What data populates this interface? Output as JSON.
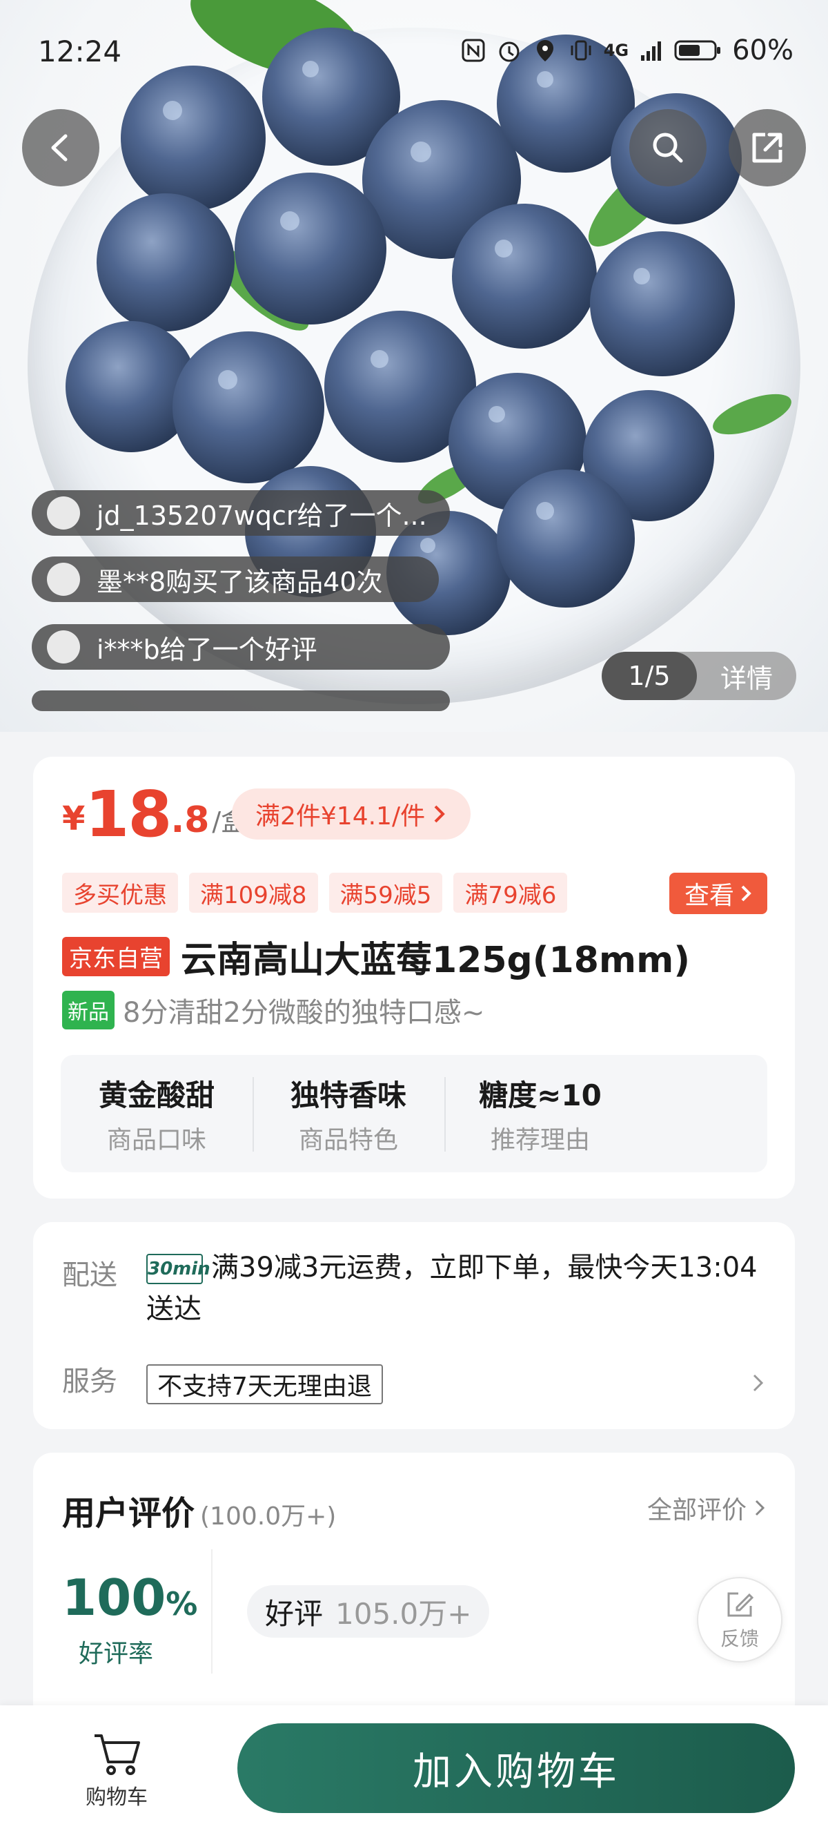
{
  "status_bar": {
    "time": "12:24",
    "battery": "60%",
    "network": "4G"
  },
  "hero": {
    "tickers": [
      {
        "text": "jd_135207wqcr给了一个..."
      },
      {
        "text": "墨**8购买了该商品40次"
      },
      {
        "text": "i***b给了一个好评"
      }
    ],
    "pager_count": "1/5",
    "pager_detail": "详情",
    "icons": {
      "back": "back-arrow-icon",
      "search": "search-icon",
      "share": "share-icon"
    }
  },
  "product": {
    "price_symbol": "¥",
    "price_integer": "18",
    "price_decimal": ".8",
    "price_unit": "/盒",
    "promo": "满2件¥14.1/件",
    "tags": [
      "多买优惠",
      "满109减8",
      "满59减5",
      "满79减6"
    ],
    "view_button": "查看",
    "badge": "京东自营",
    "title": "云南高山大蓝莓125g(18mm)",
    "new_badge": "新品",
    "subtitle": "8分清甜2分微酸的独特口感~",
    "features": [
      {
        "main": "黄金酸甜",
        "sub": "商品口味"
      },
      {
        "main": "独特香味",
        "sub": "商品特色"
      },
      {
        "main": "糖度≈10",
        "sub": "推荐理由"
      }
    ]
  },
  "delivery": {
    "label": "配送",
    "logo_text": "30min",
    "text": "满39减3元运费，立即下单，最快今天13:04送达",
    "service_label": "服务",
    "service_tag": "不支持7天无理由退"
  },
  "reviews": {
    "title": "用户评价",
    "count": "(100.0万+)",
    "all_link": "全部评价",
    "rate_value": "100",
    "rate_percent": "%",
    "rate_label": "好评率",
    "good_label": "好评",
    "good_count": "105.0万+",
    "feedback_label": "反馈"
  },
  "bottom_bar": {
    "cart_label": "购物车",
    "add_to_cart": "加入购物车"
  },
  "colors": {
    "price_red": "#e8432f",
    "brand_green": "#1f6b5a",
    "new_green": "#2fb34f"
  }
}
